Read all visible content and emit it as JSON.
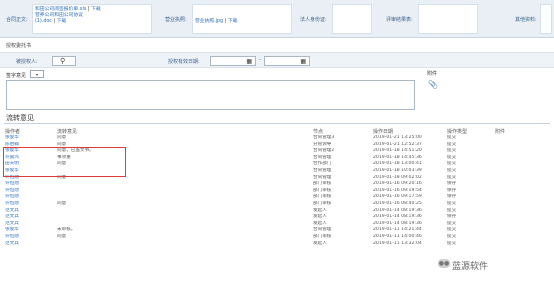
{
  "top": {
    "contract_label": "合同正文:",
    "files": [
      "和田公司阅签报价单.xls",
      "营养公司和田公司协议",
      "(1).doc"
    ],
    "download": "下载",
    "license_label": "营业执照:",
    "license_file": "营业执照.jpg",
    "idcard_label": "法人身份证:",
    "evaluation_label": "评审结果表:",
    "other_label": "其他资料:"
  },
  "auth_title": "授权委托书",
  "form": {
    "delegate_label": "被授权人:",
    "period_label": "授权有效日期:",
    "dash": "-"
  },
  "sign_label": "签字意见",
  "attachment_label": "附件",
  "flow_title": "流转意见",
  "table": {
    "headers": [
      "操作者",
      "流转意见",
      "节点",
      "操作日期",
      "操作类型",
      "附件"
    ],
    "rows": [
      [
        "张俊华",
        "同意",
        "合同管理3",
        "2019-01-21 13:25:00",
        "提交",
        ""
      ],
      [
        "陈伯翰",
        "同意",
        "分管领导",
        "2019-01-21 12:52:37",
        "提交",
        ""
      ],
      [
        "张俊华",
        "同意，已盖文书。",
        "合同管理2",
        "2019-01-18 14:51:20",
        "提交",
        ""
      ],
      [
        "许震鸿",
        "事项重",
        "合同管理",
        "2019-01-18 14:45:36",
        "提交",
        ""
      ],
      [
        "田天明",
        "同意",
        "合作部门",
        "2019-01-18 13:00:41",
        "提交",
        ""
      ],
      [
        "张俊华",
        "",
        "合同管理",
        "2019-01-18 10:03:39",
        "提交",
        ""
      ],
      [
        "许恒勋",
        "同意",
        "合同管理",
        "2019-01-18 09:02:02",
        "提交",
        ""
      ],
      [
        "许恒勋",
        "",
        "部门审核",
        "2019-01-16 09:20:16",
        "保存",
        ""
      ],
      [
        "许恒勋",
        "",
        "部门审核",
        "2019-01-16 09:19:54",
        "保存",
        ""
      ],
      [
        "许恒勋",
        "",
        "部门审核",
        "2019-01-16 09:17:59",
        "保存",
        ""
      ],
      [
        "许恒勋",
        "同意",
        "部门审核",
        "2019-01-16 08:40:25",
        "提交",
        ""
      ],
      [
        "范文兵",
        "",
        "发起人",
        "2019-01-14 08:19:36",
        "提交",
        ""
      ],
      [
        "范文兵",
        "",
        "发起人",
        "2019-01-14 08:19:36",
        "保存",
        ""
      ],
      [
        "范文兵",
        "",
        "发起人",
        "2019-01-14 08:19:36",
        "提交",
        ""
      ],
      [
        "张俊华",
        "未审核。",
        "合同管理",
        "2019-01-11 14:21:44",
        "提交",
        ""
      ],
      [
        "许恒勋",
        "同意",
        "部门审核",
        "2019-01-11 14:00:46",
        "提交",
        ""
      ],
      [
        "范文兵",
        "",
        "发起人",
        "2019-01-11 13:32:04",
        "提交",
        ""
      ]
    ]
  },
  "watermark": "蓝源软件"
}
